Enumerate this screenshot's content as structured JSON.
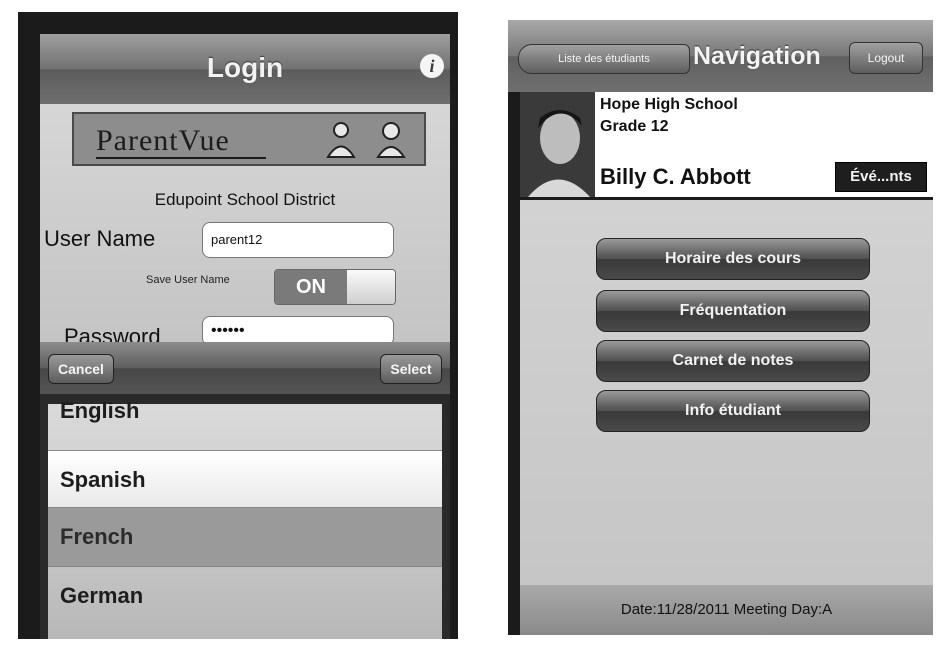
{
  "login_screen": {
    "title": "Login",
    "info_icon": "i",
    "logo_text": "ParentVue",
    "district": "Edupoint School District",
    "username_label": "User Name",
    "username_value": "parent12",
    "save_username_label": "Save User Name",
    "save_username_state": "ON",
    "password_label": "Password",
    "password_value": "••••••",
    "picker": {
      "cancel_label": "Cancel",
      "select_label": "Select",
      "options": [
        "English",
        "Spanish",
        "French",
        "German"
      ],
      "selected": "Spanish"
    }
  },
  "navigation_screen": {
    "title": "Navigation",
    "back_label": "Liste des étudiants",
    "logout_label": "Logout",
    "student": {
      "school": "Hope High School",
      "grade": "Grade 12",
      "name": "Billy C. Abbott",
      "events_label": "Évé...nts"
    },
    "menu": [
      "Horaire des cours",
      "Fréquentation",
      "Carnet de notes",
      "Info étudiant"
    ],
    "footer": "Date:11/28/2011 Meeting Day:A"
  }
}
